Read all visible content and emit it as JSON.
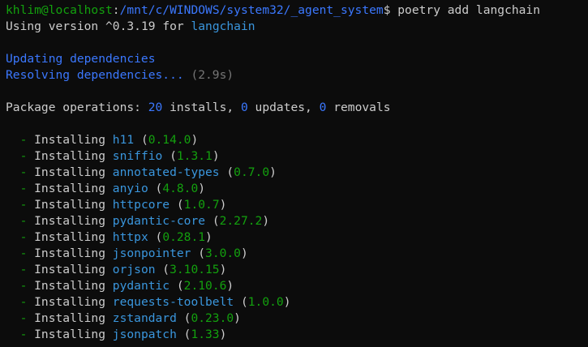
{
  "prompt": {
    "user_host": "khlim@localhost",
    "separator": ":",
    "path": "/mnt/c/WINDOWS/system32/_agent_system",
    "symbol": "$",
    "command": " poetry add langchain"
  },
  "version_line": {
    "prefix": "Using version ",
    "version": "^0.3.19",
    "middle": " for ",
    "package": "langchain"
  },
  "updating": "Updating dependencies",
  "resolving": {
    "label": "Resolving dependencies...",
    "time": " (2.9s)"
  },
  "operations": {
    "label": "Package operations: ",
    "installs_count": "20",
    "installs_label": " installs, ",
    "updates_count": "0",
    "updates_label": " updates, ",
    "removals_count": "0",
    "removals_label": " removals"
  },
  "installing_prefix": "  - Installing ",
  "packages": [
    {
      "name": "h11",
      "version": "0.14.0"
    },
    {
      "name": "sniffio",
      "version": "1.3.1"
    },
    {
      "name": "annotated-types",
      "version": "0.7.0"
    },
    {
      "name": "anyio",
      "version": "4.8.0"
    },
    {
      "name": "httpcore",
      "version": "1.0.7"
    },
    {
      "name": "pydantic-core",
      "version": "2.27.2"
    },
    {
      "name": "httpx",
      "version": "0.28.1"
    },
    {
      "name": "jsonpointer",
      "version": "3.0.0"
    },
    {
      "name": "orjson",
      "version": "3.10.15"
    },
    {
      "name": "pydantic",
      "version": "2.10.6"
    },
    {
      "name": "requests-toolbelt",
      "version": "1.0.0"
    },
    {
      "name": "zstandard",
      "version": "0.23.0"
    },
    {
      "name": "jsonpatch",
      "version": "1.33"
    }
  ],
  "colors": {
    "background": "#0c0c0c",
    "foreground": "#cccccc",
    "prompt_user": "#13a10e",
    "prompt_path": "#3b78ff",
    "package_name": "#3a96dd",
    "version": "#13a10e",
    "muted": "#767676"
  }
}
